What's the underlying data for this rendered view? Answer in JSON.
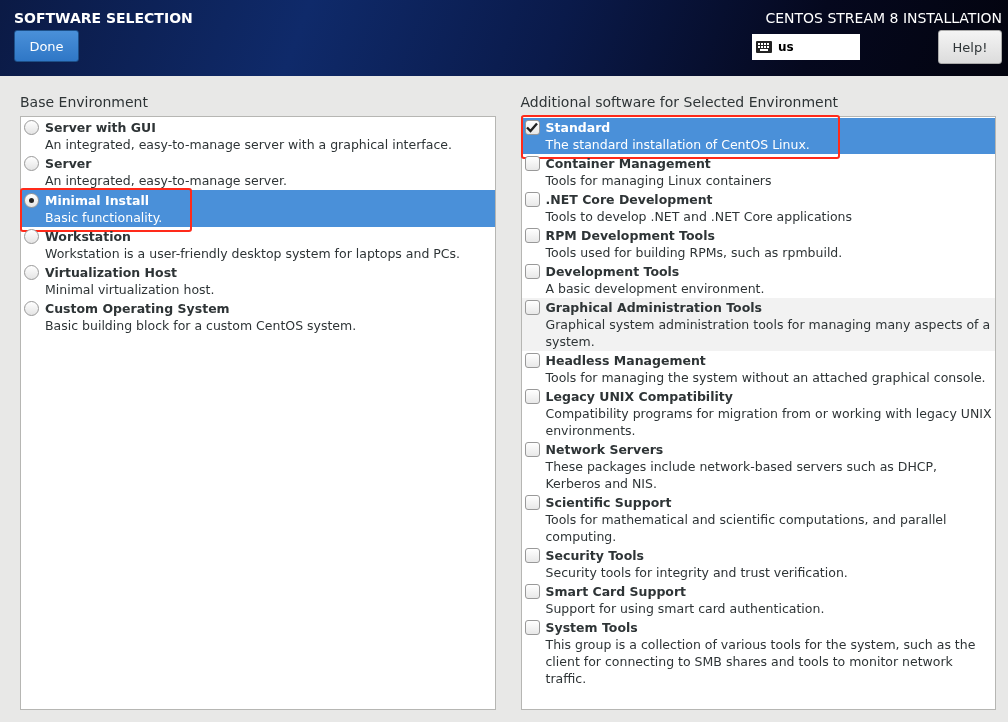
{
  "header": {
    "title": "SOFTWARE SELECTION",
    "done_button": "Done",
    "product": "CENTOS STREAM 8 INSTALLATION",
    "keyboard_layout": "us",
    "help_button": "Help!"
  },
  "base_environment": {
    "heading": "Base Environment",
    "items": [
      {
        "name": "Server with GUI",
        "description": "An integrated, easy-to-manage server with a graphical interface.",
        "selected": false,
        "annotated": false
      },
      {
        "name": "Server",
        "description": "An integrated, easy-to-manage server.",
        "selected": false,
        "annotated": false
      },
      {
        "name": "Minimal Install",
        "description": "Basic functionality.",
        "selected": true,
        "annotated": true
      },
      {
        "name": "Workstation",
        "description": "Workstation is a user-friendly desktop system for laptops and PCs.",
        "selected": false,
        "annotated": false
      },
      {
        "name": "Virtualization Host",
        "description": "Minimal virtualization host.",
        "selected": false,
        "annotated": false
      },
      {
        "name": "Custom Operating System",
        "description": "Basic building block for a custom CentOS system.",
        "selected": false,
        "annotated": false
      }
    ]
  },
  "additional_software": {
    "heading": "Additional software for Selected Environment",
    "items": [
      {
        "name": "Standard",
        "description": "The standard installation of CentOS Linux.",
        "checked": true,
        "selected": true,
        "hovered": false,
        "annotated": true
      },
      {
        "name": "Container Management",
        "description": "Tools for managing Linux containers",
        "checked": false,
        "selected": false,
        "hovered": false,
        "annotated": false
      },
      {
        "name": ".NET Core Development",
        "description": "Tools to develop .NET and .NET Core applications",
        "checked": false,
        "selected": false,
        "hovered": false,
        "annotated": false
      },
      {
        "name": "RPM Development Tools",
        "description": "Tools used for building RPMs, such as rpmbuild.",
        "checked": false,
        "selected": false,
        "hovered": false,
        "annotated": false
      },
      {
        "name": "Development Tools",
        "description": "A basic development environment.",
        "checked": false,
        "selected": false,
        "hovered": false,
        "annotated": false
      },
      {
        "name": "Graphical Administration Tools",
        "description": "Graphical system administration tools for managing many aspects of a system.",
        "checked": false,
        "selected": false,
        "hovered": true,
        "annotated": false
      },
      {
        "name": "Headless Management",
        "description": "Tools for managing the system without an attached graphical console.",
        "checked": false,
        "selected": false,
        "hovered": false,
        "annotated": false
      },
      {
        "name": "Legacy UNIX Compatibility",
        "description": "Compatibility programs for migration from or working with legacy UNIX environments.",
        "checked": false,
        "selected": false,
        "hovered": false,
        "annotated": false
      },
      {
        "name": "Network Servers",
        "description": "These packages include network-based servers such as DHCP, Kerberos and NIS.",
        "checked": false,
        "selected": false,
        "hovered": false,
        "annotated": false
      },
      {
        "name": "Scientific Support",
        "description": "Tools for mathematical and scientific computations, and parallel computing.",
        "checked": false,
        "selected": false,
        "hovered": false,
        "annotated": false
      },
      {
        "name": "Security Tools",
        "description": "Security tools for integrity and trust verification.",
        "checked": false,
        "selected": false,
        "hovered": false,
        "annotated": false
      },
      {
        "name": "Smart Card Support",
        "description": "Support for using smart card authentication.",
        "checked": false,
        "selected": false,
        "hovered": false,
        "annotated": false
      },
      {
        "name": "System Tools",
        "description": "This group is a collection of various tools for the system, such as the client for connecting to SMB shares and tools to monitor network traffic.",
        "checked": false,
        "selected": false,
        "hovered": false,
        "annotated": false
      }
    ]
  }
}
